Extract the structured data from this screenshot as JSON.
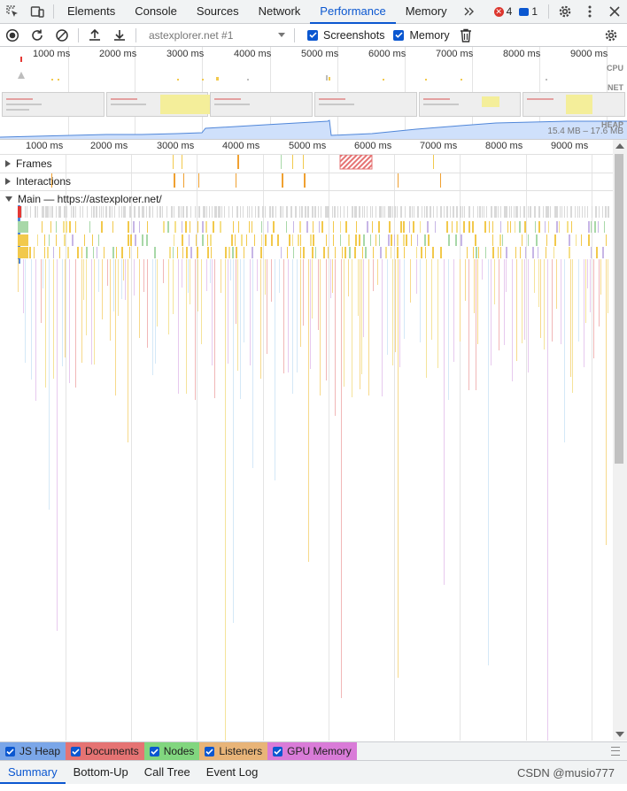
{
  "tabs": [
    {
      "label": "Elements"
    },
    {
      "label": "Console"
    },
    {
      "label": "Sources"
    },
    {
      "label": "Network"
    },
    {
      "label": "Performance"
    },
    {
      "label": "Memory"
    }
  ],
  "active_tab": "Performance",
  "errors_count": "4",
  "messages_count": "1",
  "toolbar": {
    "recording_select": "astexplorer.net #1",
    "screenshots_label": "Screenshots",
    "memory_label": "Memory",
    "screenshots_checked": true,
    "memory_checked": true
  },
  "overview": {
    "cpu_label": "CPU",
    "net_label": "NET",
    "heap_label": "HEAP",
    "heap_range": "15.4 MB – 17.6 MB",
    "ticks": [
      "1000 ms",
      "2000 ms",
      "3000 ms",
      "4000 ms",
      "5000 ms",
      "6000 ms",
      "7000 ms",
      "8000 ms",
      "9000 ms"
    ]
  },
  "ruler": {
    "ticks": [
      "1000 ms",
      "2000 ms",
      "3000 ms",
      "4000 ms",
      "5000 ms",
      "6000 ms",
      "7000 ms",
      "8000 ms",
      "9000 ms"
    ]
  },
  "tracks": {
    "frames": "Frames",
    "interactions": "Interactions",
    "main": "Main — https://astexplorer.net/"
  },
  "legend": [
    {
      "label": "JS Heap",
      "color": "#7aa6e8"
    },
    {
      "label": "Documents",
      "color": "#e57373"
    },
    {
      "label": "Nodes",
      "color": "#81d67f"
    },
    {
      "label": "Listeners",
      "color": "#e8b478"
    },
    {
      "label": "GPU Memory",
      "color": "#d97bd8"
    }
  ],
  "bottom_tabs": [
    {
      "label": "Summary"
    },
    {
      "label": "Bottom-Up"
    },
    {
      "label": "Call Tree"
    },
    {
      "label": "Event Log"
    }
  ],
  "active_bottom_tab": "Summary",
  "watermark": "CSDN @musio777"
}
